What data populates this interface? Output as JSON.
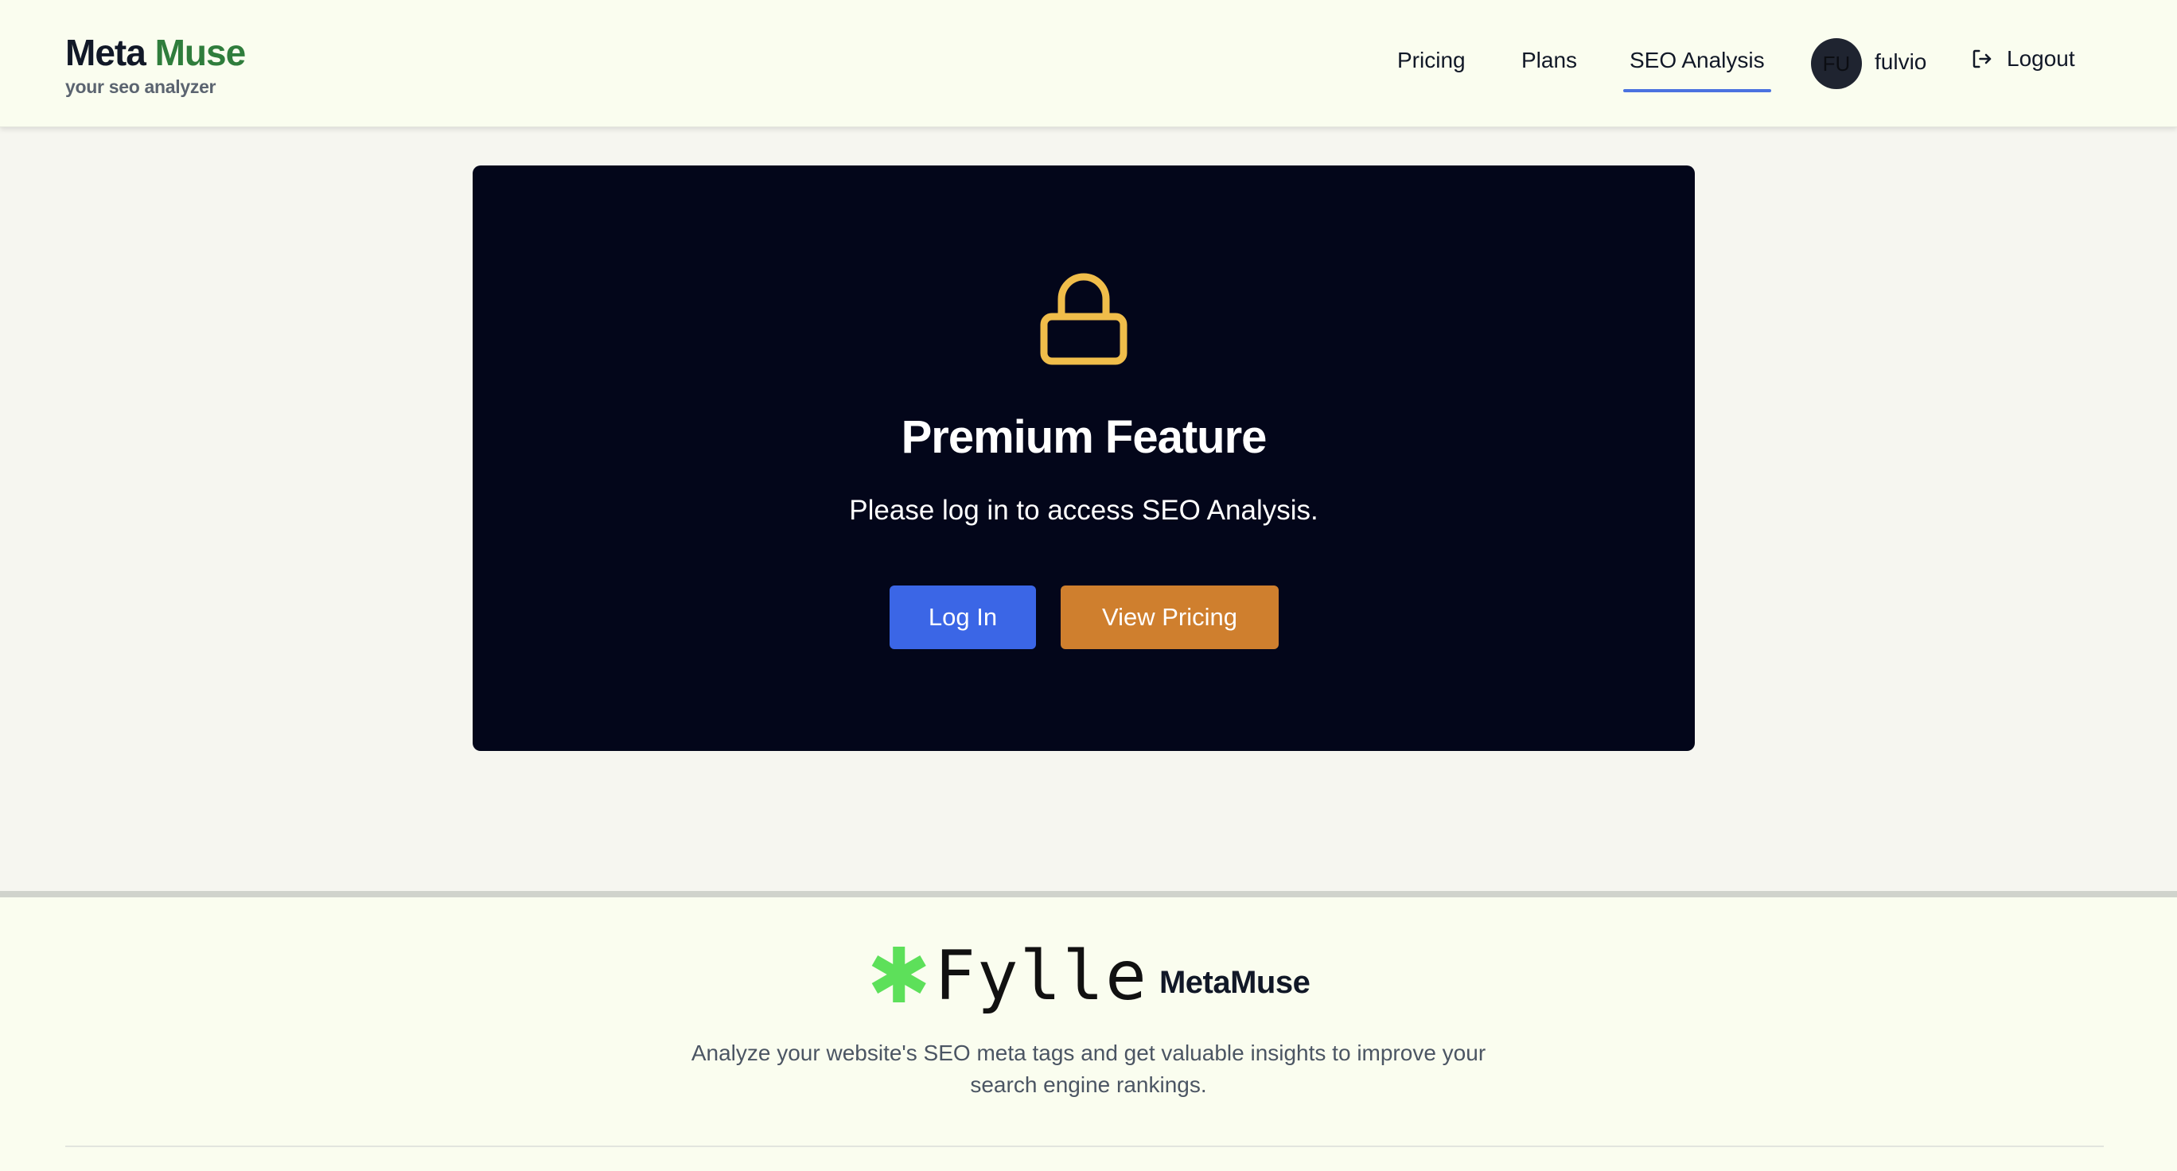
{
  "header": {
    "brand_part1": "Meta",
    "brand_part2": "Muse",
    "tagline": "your seo analyzer",
    "nav": [
      {
        "label": "Pricing"
      },
      {
        "label": "Plans"
      },
      {
        "label": "SEO Analysis",
        "active": true
      }
    ],
    "user": {
      "initials": "FU",
      "name": "fulvio"
    },
    "logout_label": "Logout",
    "icons": {
      "logout": "logout-icon"
    }
  },
  "card": {
    "icon": "lock-icon",
    "title": "Premium Feature",
    "message": "Please log in to access SEO Analysis.",
    "login_label": "Log In",
    "pricing_label": "View Pricing"
  },
  "footer": {
    "logo_star": "✱",
    "logo_word": "Fylle",
    "product_name": "MetaMuse",
    "description": "Analyze your website's SEO meta tags and get valuable insights to improve your search engine rankings."
  },
  "colors": {
    "brand_accent": "#2f7d3c",
    "card_bg": "#03061a",
    "lock": "#f0bd4a",
    "login_button": "#3b66e6",
    "pricing_button": "#cf7f2e",
    "active_underline": "#4a72e0",
    "fylle_star": "#5de05a"
  }
}
